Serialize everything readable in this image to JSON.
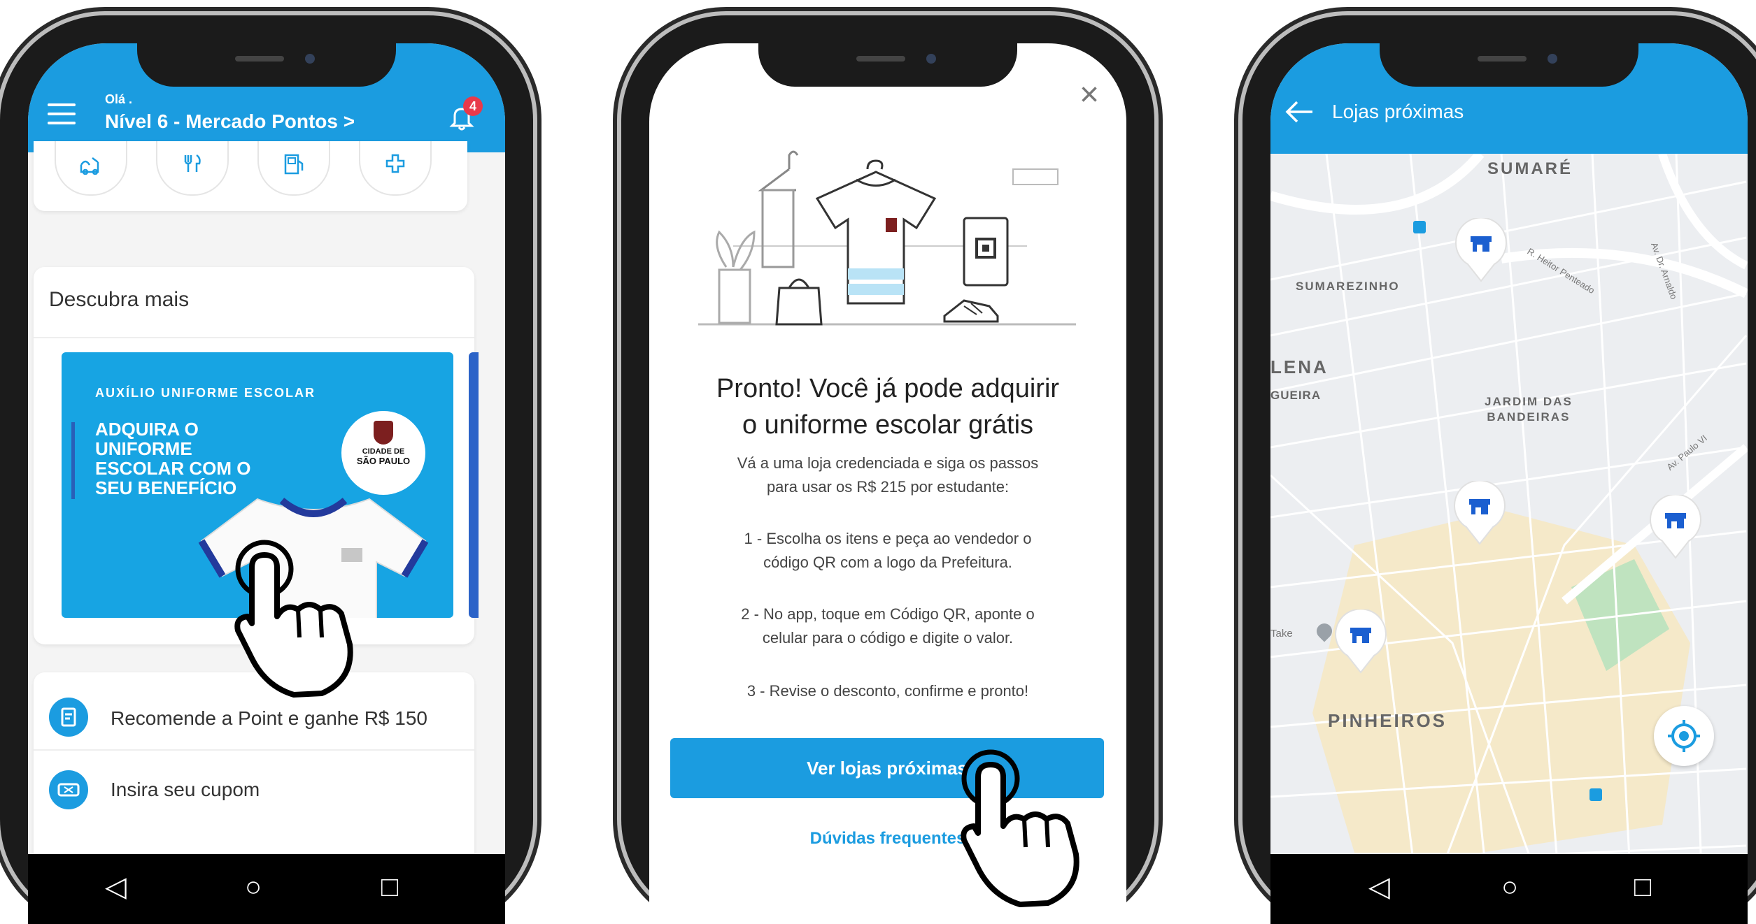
{
  "phone1": {
    "greeting": "Olá .",
    "level_title": "Nível 6 - Mercado Pontos >",
    "notification_count": "4",
    "section_title": "Descubra mais",
    "banner": {
      "label": "AUXÍLIO UNIFORME ESCOLAR",
      "headline_lines": [
        "ADQUIRA O",
        "UNIFORME",
        "ESCOLAR COM O",
        "SEU BENEFÍCIO"
      ],
      "seal_line1": "CIDADE DE",
      "seal_line2": "SÃO PAULO"
    },
    "list": [
      {
        "label": "Recomende a Point e ganhe R$ 150"
      },
      {
        "label": "Insira seu cupom"
      }
    ]
  },
  "phone2": {
    "close": "×",
    "title_line1": "Pronto! Você já pode adquirir",
    "title_line2": "o uniforme escolar grátis",
    "intro_line1": "Vá a uma loja credenciada e siga os passos",
    "intro_line2": "para usar os R$ 215 por estudante:",
    "steps": [
      {
        "line1": "1 - Escolha os itens e peça ao vendedor o",
        "line2": "código QR com a logo da Prefeitura."
      },
      {
        "line1": "2 - No app, toque em Código QR, aponte o",
        "line2": "celular para o código e digite o valor."
      },
      {
        "line1": "3 - Revise o desconto, confirme e pronto!",
        "line2": ""
      }
    ],
    "primary_button": "Ver lojas próximas",
    "faq_link": "Dúvidas frequentes"
  },
  "phone3": {
    "title": "Lojas próximas",
    "map_labels": {
      "sumare": "SUMARÉ",
      "sumarezinho": "SUMAREZINHO",
      "lena": "LENA",
      "gueira": "GUEIRA",
      "jardim_line1": "JARDIM DAS",
      "jardim_line2": "BANDEIRAS",
      "pinheiros": "PINHEIROS",
      "take": "Take",
      "rua1": "R. Heitor Penteado",
      "av1": "Av. Dr. Arnaldo",
      "av2": "Av. Paulo VI"
    }
  },
  "nav_buttons": {
    "back": "◁",
    "home": "○",
    "recent": "□"
  },
  "colors": {
    "primary_blue": "#1b9ce0",
    "notification_red": "#e8394a",
    "map_bg": "#eceef1",
    "banner_blue": "#17a4e3"
  },
  "icons": [
    "menu-icon",
    "bell-icon",
    "baby-icon",
    "restaurant-icon",
    "fuel-icon",
    "plus-icon",
    "gift-icon",
    "coupon-icon",
    "close-icon",
    "back-arrow-icon",
    "store-pin-icon",
    "locate-icon",
    "hand-pointer-icon"
  ]
}
